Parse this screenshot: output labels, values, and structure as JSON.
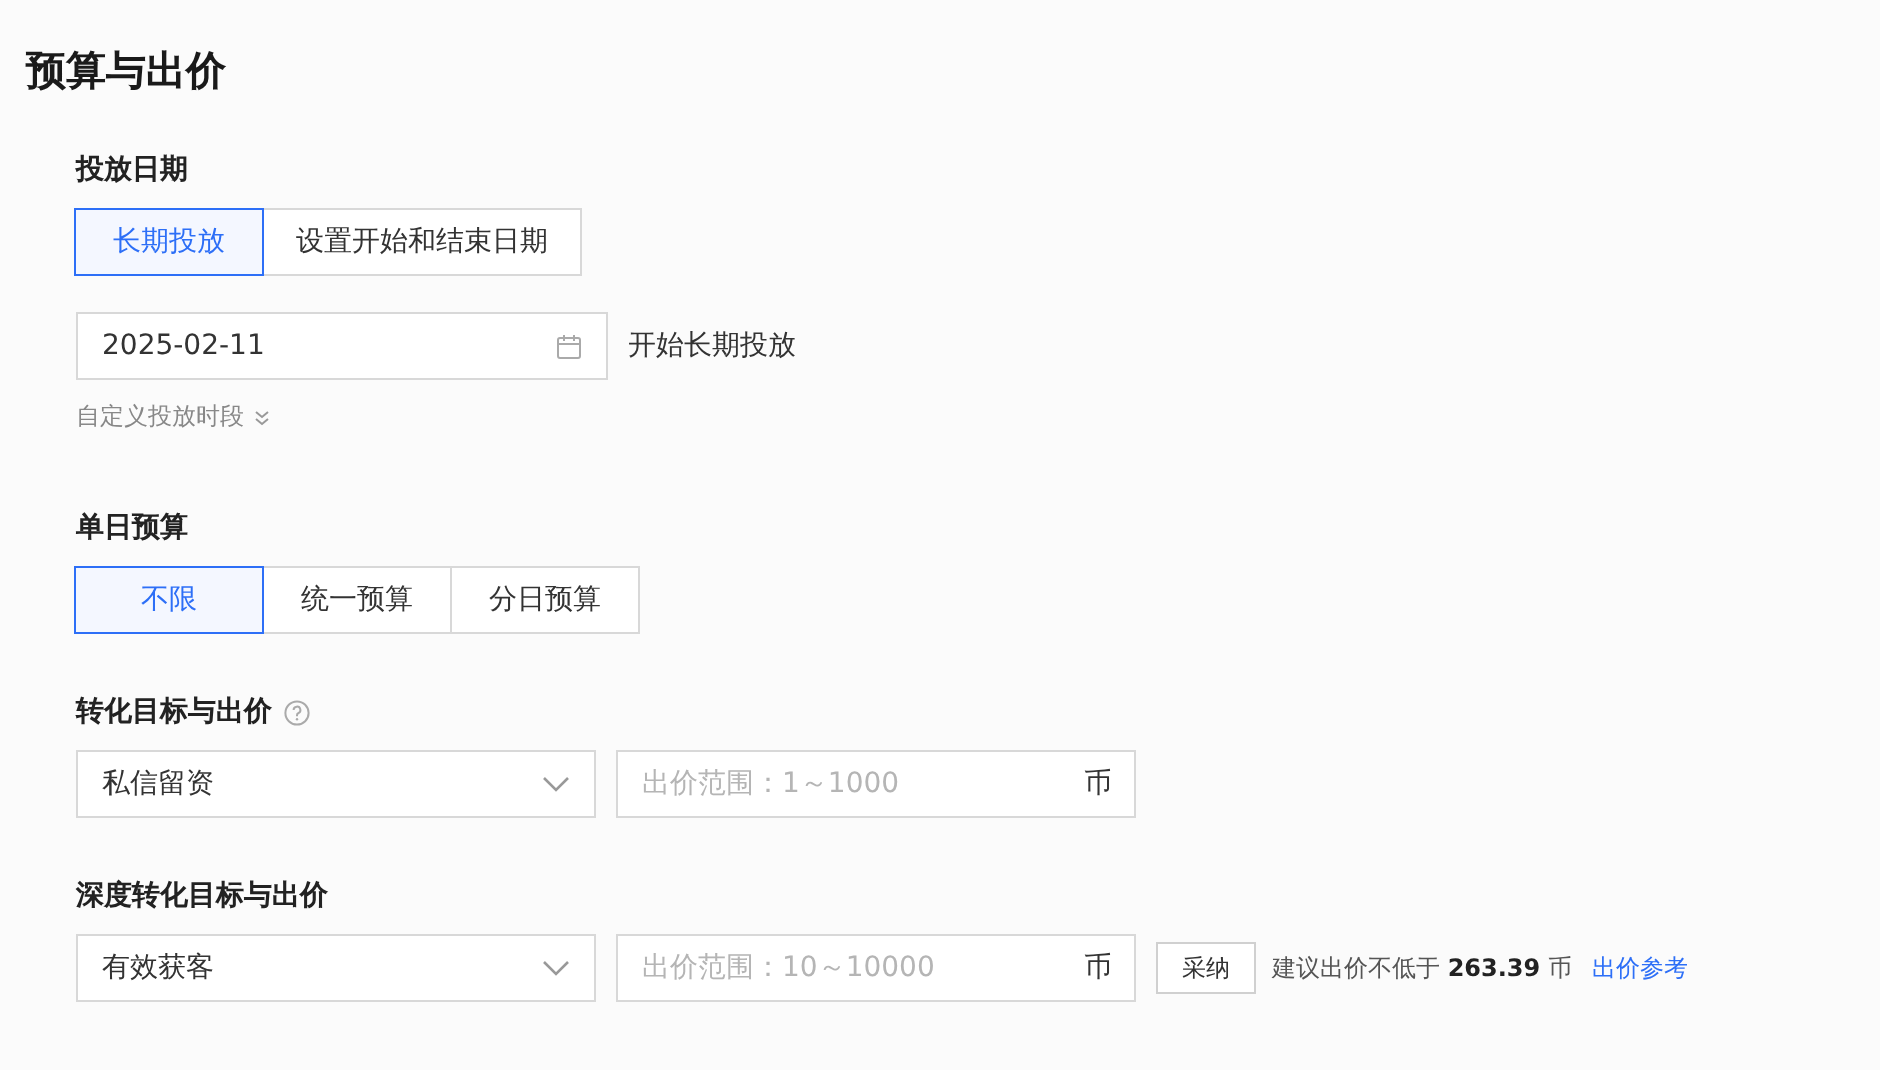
{
  "title": "预算与出价",
  "delivery_date": {
    "label": "投放日期",
    "options": [
      {
        "label": "长期投放",
        "selected": true
      },
      {
        "label": "设置开始和结束日期",
        "selected": false
      }
    ],
    "date_field": {
      "value": "2025-02-11"
    },
    "date_note": "开始长期投放",
    "custom_period_link": "自定义投放时段"
  },
  "daily_budget": {
    "label": "单日预算",
    "options": [
      {
        "label": "不限",
        "selected": true
      },
      {
        "label": "统一预算",
        "selected": false
      },
      {
        "label": "分日预算",
        "selected": false
      }
    ]
  },
  "conversion": {
    "label": "转化目标与出价",
    "goal_select": {
      "value": "私信留资"
    },
    "bid_field": {
      "placeholder": "出价范围：1～1000",
      "unit": "币"
    }
  },
  "deep_conversion": {
    "label": "深度转化目标与出价",
    "goal_select": {
      "value": "有效获客"
    },
    "bid_field": {
      "placeholder": "出价范围：10～10000",
      "unit": "币"
    },
    "adopt_button": "采纳",
    "suggestion": "建议出价不低于 **263.39** 币",
    "reference_link": "出价参考"
  }
}
